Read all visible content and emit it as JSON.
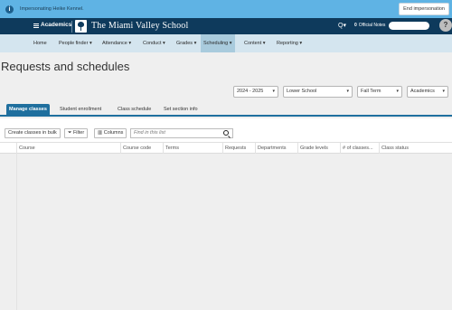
{
  "impersonation": {
    "message": "Impersonating Heike Kennel.",
    "end_button": "End impersonation"
  },
  "header": {
    "app_name": "Academics",
    "school_name": "The Miami Valley School",
    "search_caret": "Q▾",
    "notes_count": "0",
    "notes_label": "Official Notes",
    "help_label": "?"
  },
  "nav": {
    "items": [
      {
        "label": "Home"
      },
      {
        "label": "People finder ▾"
      },
      {
        "label": "Attendance ▾"
      },
      {
        "label": "Conduct ▾"
      },
      {
        "label": "Grades ▾"
      },
      {
        "label": "Scheduling ▾"
      },
      {
        "label": "Content ▾"
      },
      {
        "label": "Reporting ▾"
      }
    ]
  },
  "page": {
    "title": "Requests and schedules"
  },
  "filters": {
    "year": "2024 - 2025",
    "school": "Lower School",
    "term": "Fall Term",
    "category": "Academics"
  },
  "tabs": [
    {
      "label": "Manage classes"
    },
    {
      "label": "Student enrollment"
    },
    {
      "label": "Class schedule"
    },
    {
      "label": "Set section info"
    }
  ],
  "toolbar": {
    "create_label": "Create classes in bulk",
    "filter_label": "Filter",
    "columns_label": "Columns",
    "search_placeholder": "Find in this list"
  },
  "table": {
    "columns": [
      "Course",
      "Course code",
      "Terms",
      "Requests",
      "Departments",
      "Grade levels",
      "# of classes...",
      "Class status"
    ]
  },
  "icons": {
    "menu": "hamburger-icon",
    "logo": "school-tree-logo",
    "search": "magnifier-icon",
    "filter": "funnel-icon",
    "columns": "columns-icon",
    "info": "info-icon"
  },
  "colors": {
    "impersonation_bar": "#5fb3e4",
    "header": "#0e3a5c",
    "nav": "#d4e5ef",
    "nav_active": "#a9cbdd",
    "tab_active": "#1f6f9e"
  }
}
